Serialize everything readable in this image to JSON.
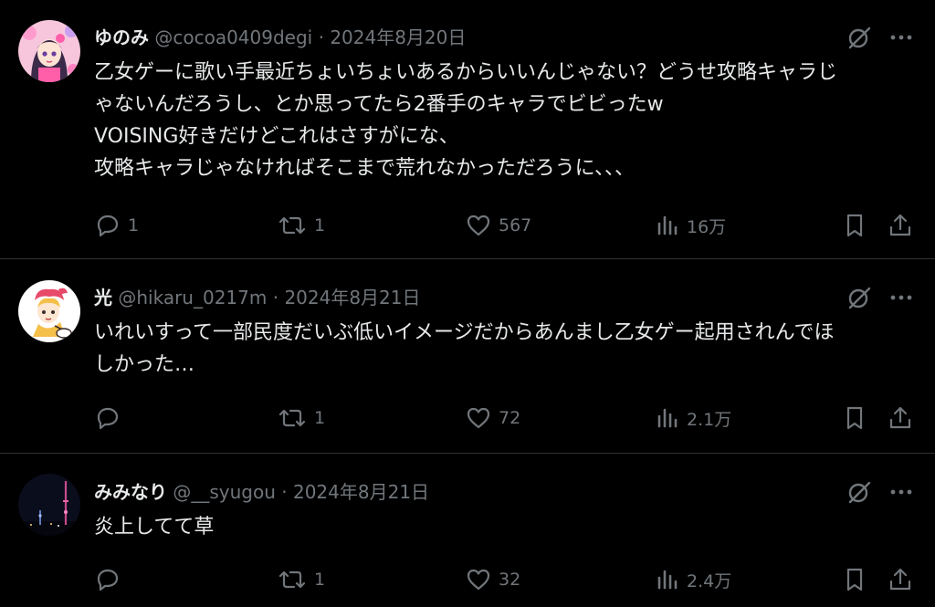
{
  "tweets": [
    {
      "display_name": "ゆのみ",
      "handle": "@cocoa0409degi",
      "separator": "·",
      "date": "2024年8月20日",
      "avatar_icon": "anime-girl-avatar",
      "text_lines": [
        "乙女ゲーに歌い手最近ちょいちょいあるからいいんじゃない？どうせ攻略キャラじ",
        "ゃないんだろうし、とか思ってたら2番手のキャラでビビったw",
        "VOISING好きだけどこれはさすがにな、",
        "攻略キャラじゃなければそこまで荒れなかっただろうに、、、"
      ],
      "replies": "1",
      "reposts": "1",
      "likes": "567",
      "views": "16万"
    },
    {
      "display_name": "光",
      "handle": "@hikaru_0217m",
      "separator": "·",
      "date": "2024年8月21日",
      "avatar_icon": "illustrated-character-avatar",
      "text_lines": [
        "いれいすって一部民度だいぶ低いイメージだからあんまし乙女ゲー起用されんでほ",
        "しかった…"
      ],
      "replies": "",
      "reposts": "1",
      "likes": "72",
      "views": "2.1万"
    },
    {
      "display_name": "みみなり",
      "handle": "@__syugou",
      "separator": "·",
      "date": "2024年8月21日",
      "avatar_icon": "night-tower-avatar",
      "text_lines": [
        "炎上してて草"
      ],
      "replies": "",
      "reposts": "1",
      "likes": "32",
      "views": "2.4万"
    }
  ],
  "colors": {
    "background": "#000000",
    "primary_text": "#e7e9ea",
    "secondary_text": "#71767b",
    "divider": "#2f3336"
  }
}
